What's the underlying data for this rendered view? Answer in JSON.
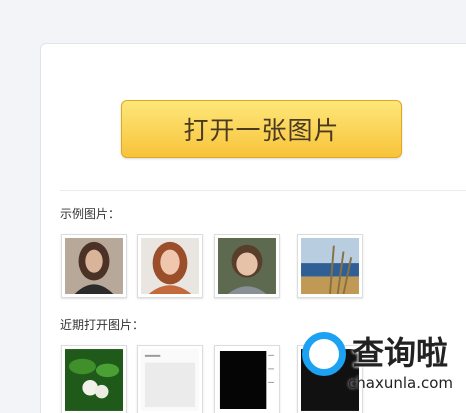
{
  "main": {
    "open_button_label": "打开一张图片",
    "examples_label": "示例图片：",
    "recent_label": "近期打开图片："
  },
  "example_images": [
    {
      "icon": "portrait-woman-brunette"
    },
    {
      "icon": "portrait-woman-redhead"
    },
    {
      "icon": "portrait-child"
    },
    {
      "icon": "seaside-grass"
    }
  ],
  "recent_images": [
    {
      "icon": "green-leaf-flower"
    },
    {
      "icon": "document-page"
    },
    {
      "icon": "black-document-page"
    },
    {
      "icon": "dark-image"
    }
  ],
  "watermark": {
    "title": "查询啦",
    "url": "chaxunla.com"
  },
  "colors": {
    "button_top": "#fde77a",
    "button_bottom": "#f8c33a",
    "watermark_blue": "#1da1f2"
  }
}
